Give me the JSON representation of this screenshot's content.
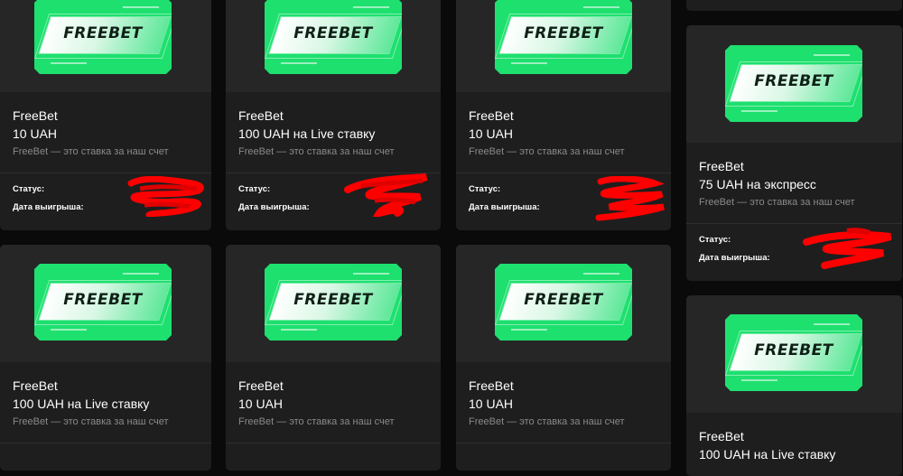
{
  "cards": [
    {
      "ticket_text": "FREEBET",
      "title": "FreeBet",
      "amount": "10 UAH",
      "description": "FreeBet — это ставка за наш счет",
      "status_label": "Статус:",
      "date_label": "Дата выигрыша:"
    },
    {
      "ticket_text": "FREEBET",
      "title": "FreeBet",
      "amount": "100 UAH на Live ставку",
      "description": "FreeBet — это ставка за наш счет",
      "status_label": "Статус:",
      "date_label": "Дата выигрыша:"
    },
    {
      "ticket_text": "FREEBET",
      "title": "FreeBet",
      "amount": "10 UAH",
      "description": "FreeBet — это ставка за наш счет",
      "status_label": "Статус:",
      "date_label": "Дата выигрыша:"
    },
    {
      "ticket_text": "FREEBET",
      "title": "FreeBet",
      "amount": "75 UAH на экспресс",
      "description": "FreeBet — это ставка за наш счет",
      "status_label": "Статус:",
      "date_label": "Дата выигрыша:"
    },
    {
      "ticket_text": "FREEBET",
      "title": "FreeBet",
      "amount": "100 UAH на Live ставку",
      "description": "FreeBet — это ставка за наш счет"
    },
    {
      "ticket_text": "FREEBET",
      "title": "FreeBet",
      "amount": "10 UAH",
      "description": "FreeBet — это ставка за наш счет"
    },
    {
      "ticket_text": "FREEBET",
      "title": "FreeBet",
      "amount": "10 UAH",
      "description": "FreeBet — это ставка за наш счет"
    },
    {
      "ticket_text": "FREEBET",
      "title": "FreeBet",
      "amount": "100 UAH на Live ставку"
    }
  ],
  "colors": {
    "background": "#0a0a0a",
    "card": "#1e1e1e",
    "ticket": "#1ee06f",
    "redaction": "#ff0000"
  }
}
